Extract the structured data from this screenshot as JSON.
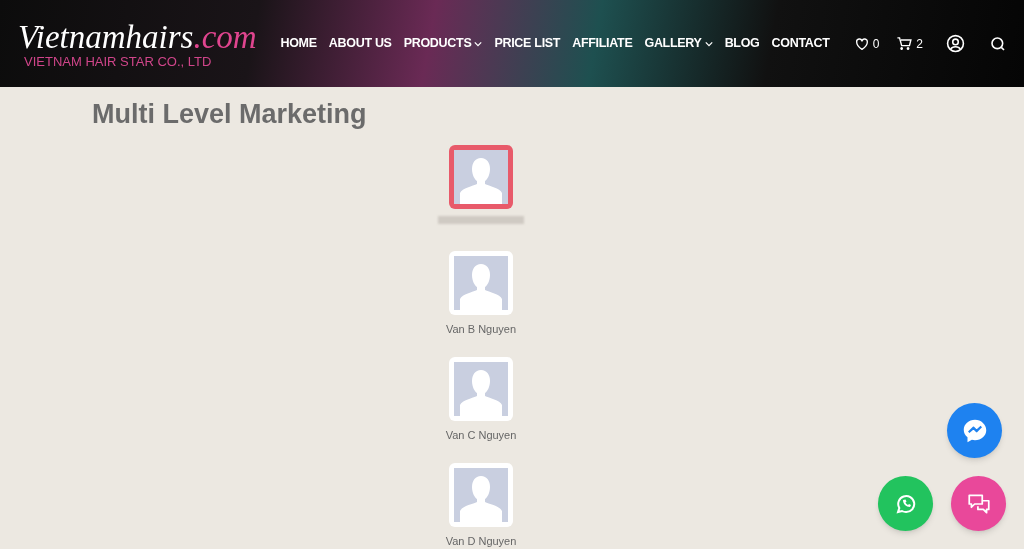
{
  "logo": {
    "name": "Vietnamhairs",
    "suffix": ".com",
    "tagline": "VIETNAM HAIR STAR CO., LTD"
  },
  "nav": [
    {
      "label": "HOME",
      "dropdown": false
    },
    {
      "label": "ABOUT US",
      "dropdown": false
    },
    {
      "label": "PRODUCTS",
      "dropdown": true
    },
    {
      "label": "PRICE LIST",
      "dropdown": false
    },
    {
      "label": "AFFILIATE",
      "dropdown": false
    },
    {
      "label": "GALLERY",
      "dropdown": true
    },
    {
      "label": "BLOG",
      "dropdown": false
    },
    {
      "label": "CONTACT",
      "dropdown": false
    }
  ],
  "wishlist_count": "0",
  "cart_count": "2",
  "page_title": "Multi Level Marketing",
  "members": [
    {
      "selected": true
    },
    {
      "name": "Van B Nguyen",
      "selected": false
    },
    {
      "name": "Van C Nguyen",
      "selected": false
    },
    {
      "name": "Van D Nguyen",
      "selected": false
    }
  ]
}
